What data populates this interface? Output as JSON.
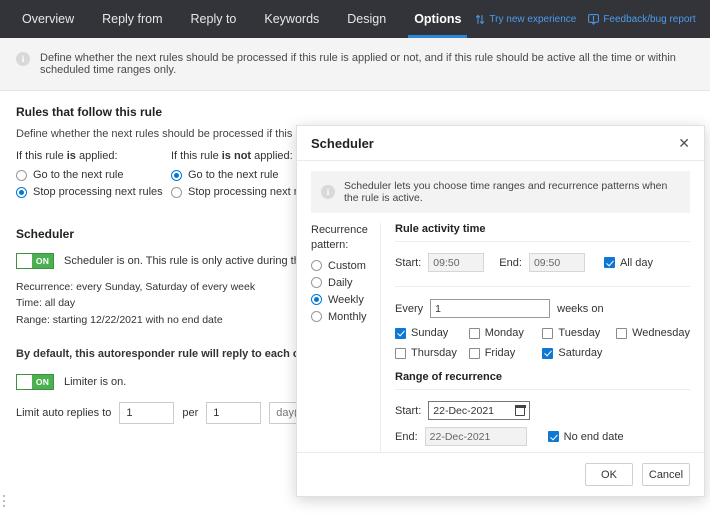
{
  "navbar": {
    "tabs": [
      {
        "label": "Overview",
        "active": false
      },
      {
        "label": "Reply from",
        "active": false
      },
      {
        "label": "Reply to",
        "active": false
      },
      {
        "label": "Keywords",
        "active": false
      },
      {
        "label": "Design",
        "active": false
      },
      {
        "label": "Options",
        "active": true
      }
    ],
    "try_new_experience": "Try new experience",
    "feedback": "Feedback/bug report",
    "link_color": "#4e9bea",
    "accent_color": "#2b88d8",
    "background": "#32343a"
  },
  "banner": {
    "icon": "info-icon",
    "text": "Define whether the next rules should be processed if this rule is applied or not, and if this rule should be active all the time or within scheduled time ranges only."
  },
  "rules_section": {
    "title": "Rules that follow this rule",
    "description": "Define whether the next rules should be processed if this rule is applied or not.",
    "applied": {
      "label_prefix": "If this rule ",
      "label_bold": "is",
      "label_suffix": " applied:",
      "options": [
        {
          "label": "Go to the next rule",
          "checked": false
        },
        {
          "label": "Stop processing next rules",
          "checked": true
        }
      ]
    },
    "not_applied": {
      "label_prefix": "If this rule ",
      "label_bold": "is not",
      "label_suffix": " applied:",
      "options": [
        {
          "label": "Go to the next rule",
          "checked": true
        },
        {
          "label": "Stop processing next rules",
          "checked": false
        }
      ]
    }
  },
  "scheduler_section": {
    "title": "Scheduler",
    "toggle_label": "ON",
    "toggle_text": "Scheduler is on. This rule is only active during the time ranges defined",
    "recurrence_line": "Recurrence: every Sunday, Saturday of every week",
    "time_line": "Time: all day",
    "range_line": "Range: starting 12/22/2021 with no end date"
  },
  "limiter_section": {
    "paragraph": "By default, this autoresponder rule will reply to each original sender in this rule according to your needs.",
    "toggle_label": "ON",
    "toggle_text": "Limiter is on.",
    "limit_label": "Limit auto replies to",
    "limit_value": "1",
    "per_label": "per",
    "per_value": "1",
    "unit_value": "day(s)"
  },
  "modal": {
    "title": "Scheduler",
    "close_icon": "close-icon",
    "info": "Scheduler lets you choose time ranges and recurrence patterns when the rule is active.",
    "recurrence": {
      "title": "Recurrence pattern:",
      "options": [
        {
          "label": "Custom",
          "checked": false
        },
        {
          "label": "Daily",
          "checked": false
        },
        {
          "label": "Weekly",
          "checked": true
        },
        {
          "label": "Monthly",
          "checked": false
        }
      ]
    },
    "activity": {
      "title": "Rule activity time",
      "start_label": "Start:",
      "start_value": "09:50",
      "end_label": "End:",
      "end_value": "09:50",
      "all_day_label": "All day",
      "all_day_checked": true
    },
    "every": {
      "prefix": "Every",
      "value": "1",
      "suffix": "weeks on"
    },
    "days": [
      {
        "label": "Sunday",
        "checked": true
      },
      {
        "label": "Monday",
        "checked": false
      },
      {
        "label": "Tuesday",
        "checked": false
      },
      {
        "label": "Wednesday",
        "checked": false
      },
      {
        "label": "Thursday",
        "checked": false
      },
      {
        "label": "Friday",
        "checked": false
      },
      {
        "label": "Saturday",
        "checked": true
      }
    ],
    "range": {
      "title": "Range of recurrence",
      "start_label": "Start:",
      "start_value": "22-Dec-2021",
      "end_label": "End:",
      "end_value": "22-Dec-2021",
      "no_end_label": "No end date",
      "no_end_checked": true
    },
    "ok_label": "OK",
    "cancel_label": "Cancel"
  }
}
